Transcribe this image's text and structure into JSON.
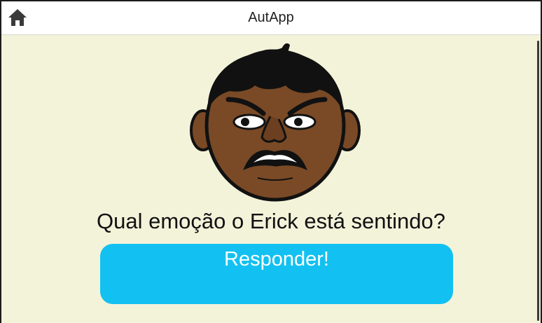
{
  "app": {
    "title": "AutApp",
    "home_icon": "home-icon"
  },
  "colors": {
    "background": "#f3f3da",
    "accent": "#12c1f1",
    "skin": "#7a4a26",
    "hair": "#111111"
  },
  "main": {
    "face_image": "angry-boy-face",
    "question": "Qual emoção o Erick está sentindo?",
    "answer_button_label": "Responder!"
  }
}
